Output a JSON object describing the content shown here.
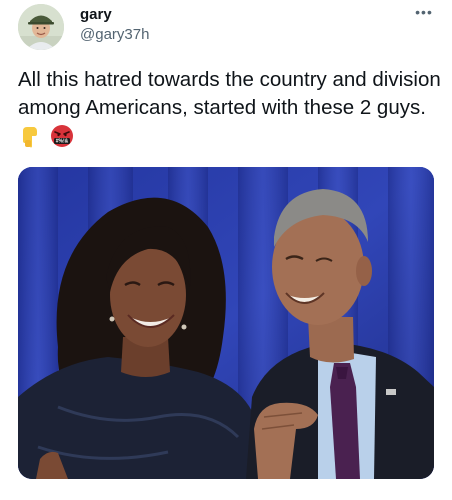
{
  "tweet": {
    "display_name": "gary",
    "handle": "@gary37h",
    "more_label": "•••",
    "text": "All this hatred towards the country and division among Americans, started with these 2 guys. ",
    "emoji": [
      {
        "name": "pointing-down-emoji",
        "glyph": "backhand-index-pointing-down"
      },
      {
        "name": "angry-cursing-face-emoji",
        "glyph": "face-with-symbols-on-mouth",
        "symbols": "#%!&"
      }
    ]
  },
  "colors": {
    "text_primary": "#0f1419",
    "text_secondary": "#536471",
    "photo_backdrop": "#2b3fae"
  }
}
